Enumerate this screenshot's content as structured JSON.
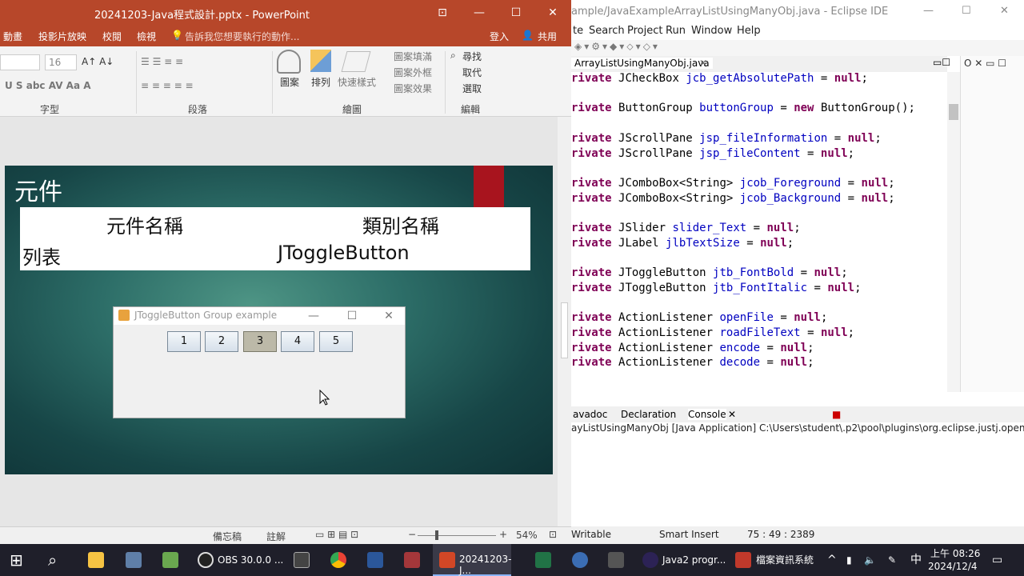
{
  "ppt": {
    "title": "20241203-Java程式設計.pptx - PowerPoint",
    "tabs": [
      "動畫",
      "投影片放映",
      "校閱",
      "檢視"
    ],
    "tell_me": "告訴我您想要執行的動作...",
    "signin": "登入",
    "share": "共用",
    "font_size": "16",
    "groups": [
      "字型",
      "段落",
      "繪圖",
      "編輯"
    ],
    "ribbon": {
      "shape": "圖案",
      "arrange": "排列",
      "quick_styles": "快速樣式",
      "fill": "圖案填滿",
      "outline": "圖案外框",
      "effects": "圖案效果",
      "find": "尋找",
      "replace": "取代",
      "select": "選取"
    },
    "slide": {
      "title": "元件",
      "col1": "元件名稱",
      "col2": "類別名稱",
      "row1_c1": "列表",
      "row1_c2": "JToggleButton"
    },
    "java_window": {
      "title": "JToggleButton Group example",
      "buttons": [
        "1",
        "2",
        "3",
        "4",
        "5"
      ],
      "selected": "3"
    },
    "status": {
      "notes": "備忘稿",
      "comments": "註解",
      "zoom": "54%"
    }
  },
  "eclipse": {
    "title": "ample/JavaExampleArrayListUsingManyObj.java - Eclipse IDE",
    "menu": [
      "te",
      "Search",
      "Project",
      "Run",
      "Window",
      "Help"
    ],
    "editor_tab": "ArrayListUsingManyObj.java",
    "code_lines": [
      "rivate JCheckBox jcb_getAbsolutePath = null;",
      "",
      "rivate ButtonGroup buttonGroup = new ButtonGroup();",
      "",
      "rivate JScrollPane jsp_fileInformation = null;",
      "rivate JScrollPane jsp_fileContent = null;",
      "",
      "rivate JComboBox<String> jcob_Foreground = null;",
      "rivate JComboBox<String> jcob_Background = null;",
      "",
      "rivate JSlider slider_Text = null;",
      "rivate JLabel jlbTextSize = null;",
      "",
      "rivate JToggleButton jtb_FontBold = null;",
      "rivate JToggleButton jtb_FontItalic = null;",
      "",
      "rivate ActionListener openFile = null;",
      "rivate ActionListener roadFileText = null;",
      "rivate ActionListener encode = null;",
      "rivate ActionListener decode = null;"
    ],
    "bottom_tabs": [
      "avadoc",
      "Declaration",
      "Console"
    ],
    "console": "ayListUsingManyObj [Java Application] C:\\Users\\student\\.p2\\pool\\plugins\\org.eclipse.justj.openjdk.h",
    "status": {
      "mode": "Writable",
      "insert": "Smart Insert",
      "pos": "75 : 49 : 2389"
    }
  },
  "taskbar": {
    "apps": [
      "OBS 30.0.0 ...",
      "20241203-J...",
      "Java2 progr...",
      "檔案資訊系統"
    ],
    "ime": "中",
    "time": "上午 08:26",
    "date": "2024/12/4"
  }
}
